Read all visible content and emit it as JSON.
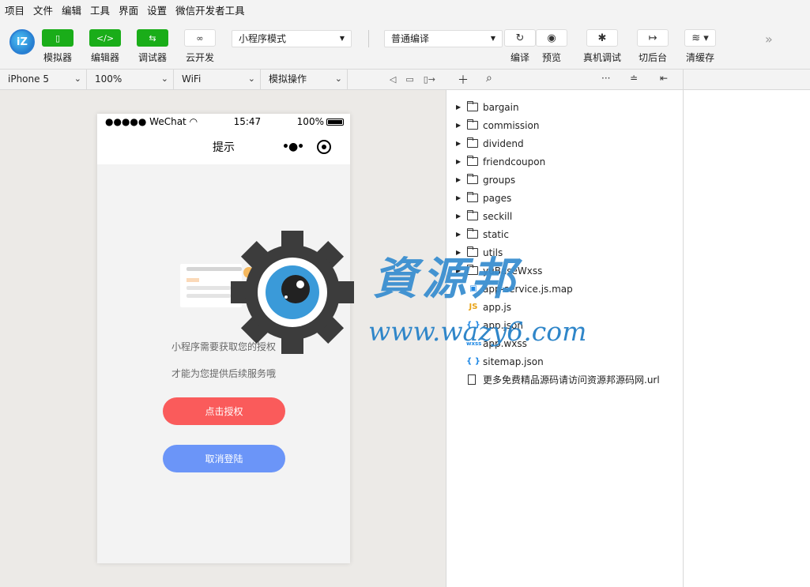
{
  "menu": [
    "项目",
    "文件",
    "编辑",
    "工具",
    "界面",
    "设置",
    "微信开发者工具"
  ],
  "toolbar": {
    "logo_text": "iZ",
    "simulator_label": "模拟器",
    "editor_label": "编辑器",
    "debugger_label": "调试器",
    "cloud_label": "云开发",
    "mode_select": "小程序模式",
    "compile_select": "普通编译",
    "compile_label": "编译",
    "preview_label": "预览",
    "realdebug_label": "真机调试",
    "background_label": "切后台",
    "clearcache_label": "清缓存"
  },
  "devbar": {
    "device": "iPhone 5",
    "zoom": "100%",
    "network": "WiFi",
    "operation": "模拟操作"
  },
  "phone": {
    "signal": "●●●●● WeChat",
    "time": "15:47",
    "battery": "100%",
    "nav_title": "提示",
    "message_1": "小程序需要获取您的授权",
    "message_2": "才能为您提供后续服务哦",
    "auth_button": "点击授权",
    "cancel_button": "取消登陆"
  },
  "files": [
    {
      "type": "folder",
      "name": "bargain"
    },
    {
      "type": "folder",
      "name": "commission"
    },
    {
      "type": "folder",
      "name": "dividend"
    },
    {
      "type": "folder",
      "name": "friendcoupon"
    },
    {
      "type": "folder",
      "name": "groups"
    },
    {
      "type": "folder",
      "name": "pages"
    },
    {
      "type": "folder",
      "name": "seckill"
    },
    {
      "type": "folder",
      "name": "static"
    },
    {
      "type": "folder",
      "name": "utils"
    },
    {
      "type": "folder",
      "name": "yuBaseWxss"
    },
    {
      "type": "map",
      "name": "app-service.js.map"
    },
    {
      "type": "js",
      "name": "app.js"
    },
    {
      "type": "json",
      "name": "app.json"
    },
    {
      "type": "wxss",
      "name": "app.wxss"
    },
    {
      "type": "json",
      "name": "sitemap.json"
    },
    {
      "type": "doc",
      "name": "更多免费精品源码请访问资源邦源码网.url"
    }
  ],
  "file_type_labels": {
    "js": "JS",
    "json": "{ }",
    "wxss": "wxss",
    "map": "▣"
  },
  "watermark": {
    "title": "資源邦",
    "url": "www.wazy6.com"
  },
  "colors": {
    "accent_green": "#1aad19",
    "auth_red": "#fa5b5b",
    "cancel_blue": "#6b95f8",
    "watermark_blue": "#3a8fd0"
  }
}
